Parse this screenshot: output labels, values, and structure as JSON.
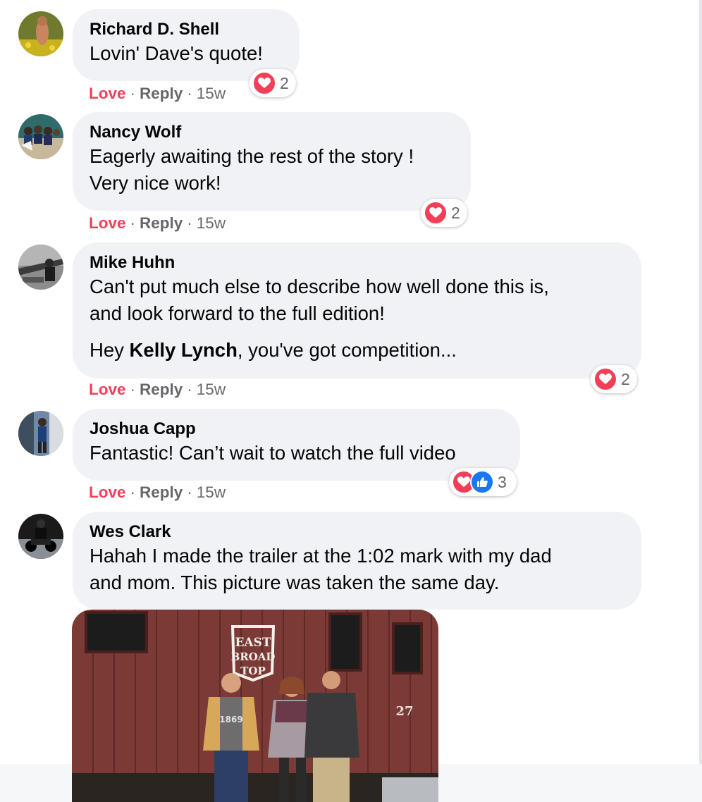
{
  "comments": [
    {
      "author": "Richard D. Shell",
      "lines": [
        "Lovin' Dave's quote!"
      ],
      "actions": {
        "love": "Love",
        "reply": "Reply",
        "time": "15w"
      },
      "reactions": {
        "count": "2",
        "types": [
          "love"
        ]
      }
    },
    {
      "author": "Nancy Wolf",
      "lines": [
        "Eagerly awaiting the rest of the story !",
        "Very nice work!"
      ],
      "actions": {
        "love": "Love",
        "reply": "Reply",
        "time": "15w"
      },
      "reactions": {
        "count": "2",
        "types": [
          "love"
        ]
      }
    },
    {
      "author": "Mike Huhn",
      "lines": [
        "Can't put much else to describe how well done this is,",
        "and look forward to the full edition!"
      ],
      "extra": {
        "prefix": "Hey ",
        "mention": "Kelly Lynch",
        "suffix": ", you've got competition..."
      },
      "actions": {
        "love": "Love",
        "reply": "Reply",
        "time": "15w"
      },
      "reactions": {
        "count": "2",
        "types": [
          "love"
        ]
      }
    },
    {
      "author": "Joshua Capp",
      "lines": [
        "Fantastic! Can’t wait to watch the full video"
      ],
      "actions": {
        "love": "Love",
        "reply": "Reply",
        "time": "15w"
      },
      "reactions": {
        "count": "3",
        "types": [
          "love",
          "like"
        ]
      }
    },
    {
      "author": "Wes Clark",
      "lines": [
        "Hahah I made the trailer at the 1:02 mark with my dad",
        "and mom. This picture was taken the same day."
      ],
      "attachment": {
        "sign": [
          "EAST",
          "BROAD",
          "TOP"
        ],
        "car_number": "27",
        "shirt_text": "1869"
      }
    }
  ],
  "separator": "·",
  "colors": {
    "love": "#f33e58",
    "like": "#1877f2",
    "bubble": "#f0f2f5",
    "meta": "#65676b"
  },
  "icons": {
    "love": "heart-icon",
    "like": "thumbs-up-icon"
  }
}
